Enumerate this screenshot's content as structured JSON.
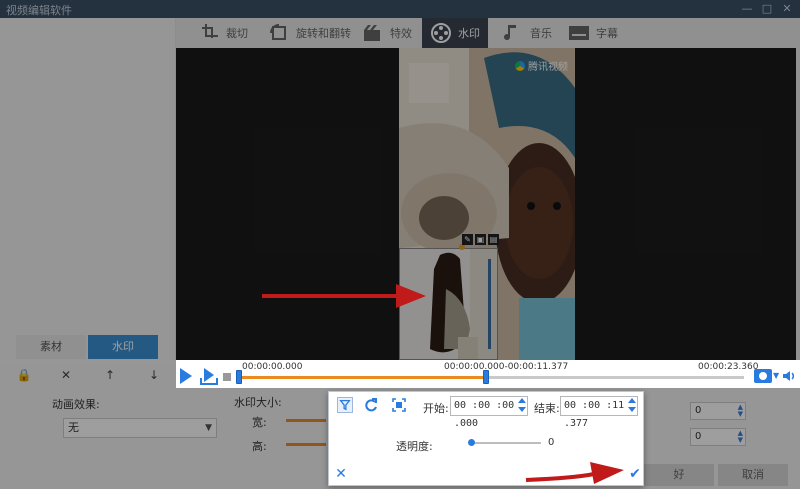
{
  "app": {
    "title": "视频编辑软件",
    "window_controls": {
      "minimize": "—",
      "maximize": "□",
      "close": "✕"
    }
  },
  "toolbar": {
    "items": [
      {
        "label": "裁切",
        "icon": "crop-icon"
      },
      {
        "label": "旋转和翻转",
        "icon": "rotate-icon"
      },
      {
        "label": "特效",
        "icon": "effects-icon"
      },
      {
        "label": "水印",
        "icon": "watermark-icon",
        "active": true
      },
      {
        "label": "音乐",
        "icon": "music-icon"
      },
      {
        "label": "字幕",
        "icon": "subtitle-icon"
      }
    ]
  },
  "left_panel": {
    "tabs": [
      "素材",
      "水印"
    ],
    "active_tab": "水印"
  },
  "video": {
    "logo_text": "腾讯视频"
  },
  "timeline": {
    "start_time": "00:00:00.000",
    "range_time": "00:00:00.000-00:00:11.377",
    "end_time": "00:00:23.360",
    "progress_fraction": 0.49
  },
  "bottom": {
    "anim_label": "动画效果:",
    "anim_value": "无",
    "wm_size_label": "水印大小:",
    "width_label": "宽:",
    "height_label": "高:",
    "spin_a": "0",
    "spin_b": "0",
    "ok_label": "好",
    "cancel_label": "取消"
  },
  "popup": {
    "start_label": "开始:",
    "start_value": "00 :00 :00 .000",
    "end_label": "结束:",
    "end_value": "00 :00 :11 .377",
    "opacity_label": "透明度:",
    "opacity_value": "0",
    "opacity_fraction": 0.0
  },
  "colors": {
    "accent_blue": "#2a7be0",
    "progress_orange": "#ea8a1f",
    "annotation_red": "#c01a1a"
  }
}
